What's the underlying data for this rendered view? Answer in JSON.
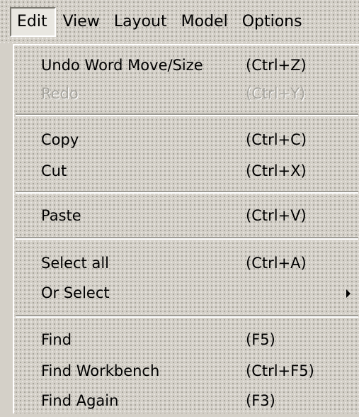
{
  "menubar": {
    "items": [
      {
        "label": "Edit"
      },
      {
        "label": "View"
      },
      {
        "label": "Layout"
      },
      {
        "label": "Model"
      },
      {
        "label": "Options"
      }
    ]
  },
  "edit_menu": {
    "undo": {
      "label": "Undo Word Move/Size",
      "shortcut": "(Ctrl+Z)"
    },
    "redo": {
      "label": "Redo",
      "shortcut": "(Ctrl+Y)",
      "enabled": false
    },
    "copy": {
      "label": "Copy",
      "shortcut": "(Ctrl+C)"
    },
    "cut": {
      "label": "Cut",
      "shortcut": "(Ctrl+X)"
    },
    "paste": {
      "label": "Paste",
      "shortcut": "(Ctrl+V)"
    },
    "select_all": {
      "label": "Select all",
      "shortcut": "(Ctrl+A)"
    },
    "or_select": {
      "label": "Or Select",
      "has_submenu": true
    },
    "find": {
      "label": "Find",
      "shortcut": "(F5)"
    },
    "find_workbench": {
      "label": "Find Workbench",
      "shortcut": "(Ctrl+F5)"
    },
    "find_again": {
      "label": "Find Again",
      "shortcut": "(F3)"
    }
  }
}
